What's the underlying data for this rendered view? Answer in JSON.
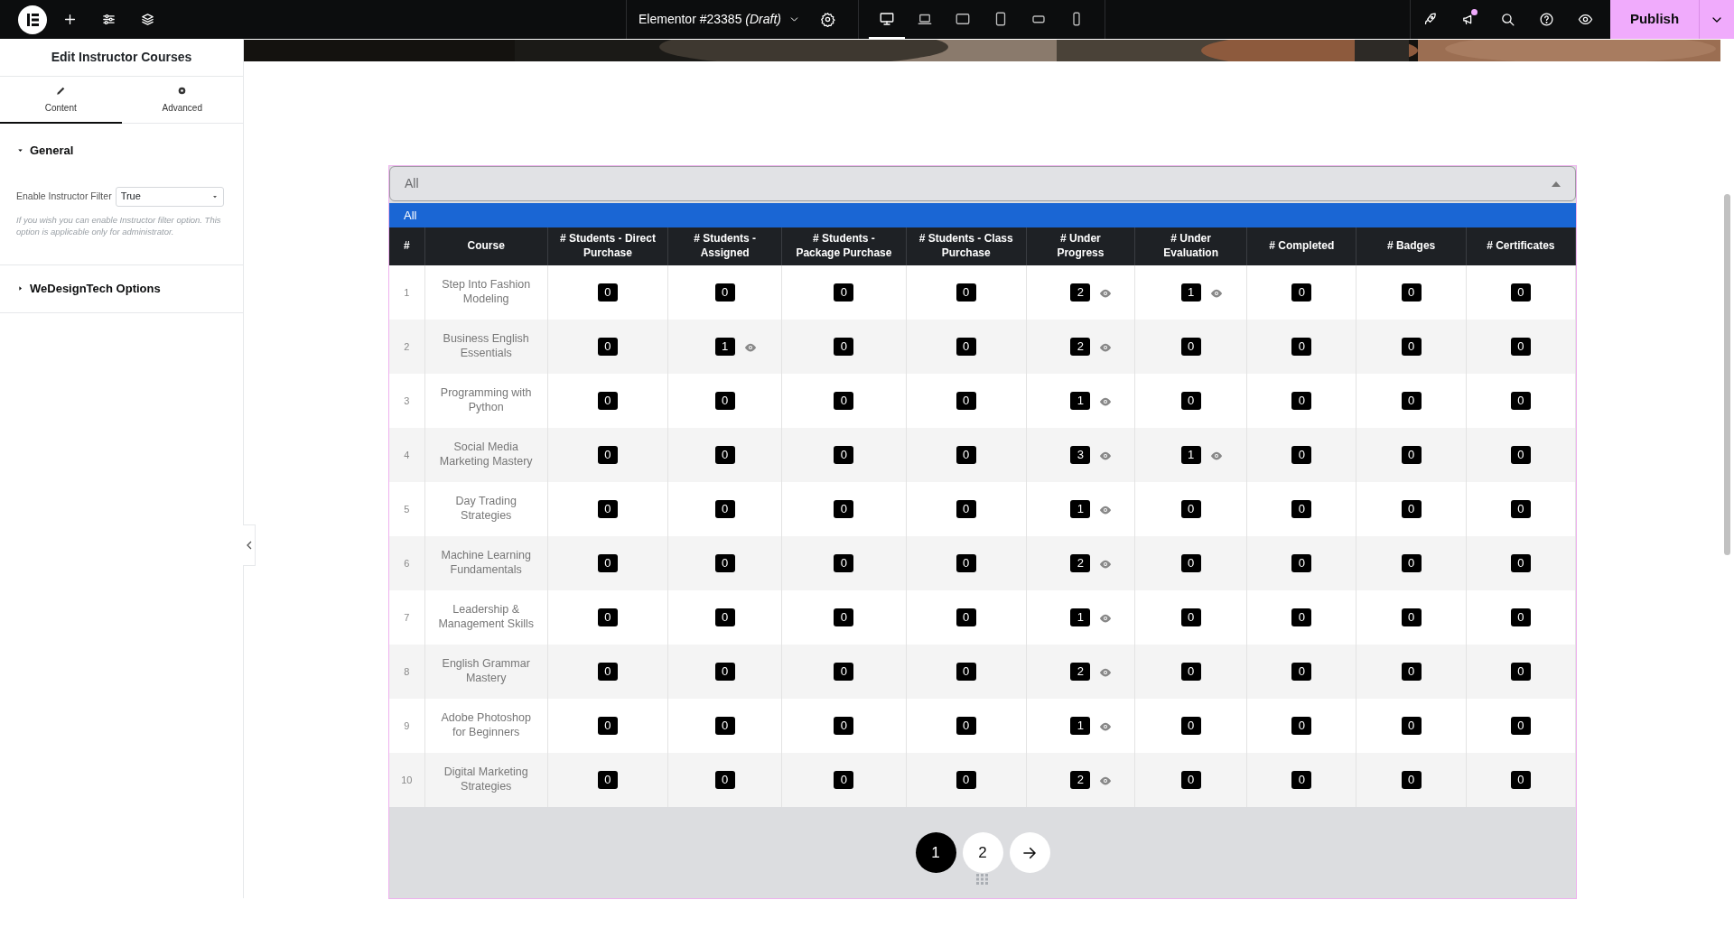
{
  "topbar": {
    "document_title": "Elementor #23385 *(Draft)*",
    "devices": [
      {
        "kind": "desktop",
        "selected": true
      },
      {
        "kind": "laptop",
        "selected": false
      },
      {
        "kind": "tablet-landscape",
        "selected": false
      },
      {
        "kind": "tablet",
        "selected": false
      },
      {
        "kind": "mobile-landscape",
        "selected": false
      },
      {
        "kind": "mobile",
        "selected": false
      }
    ],
    "notification": true,
    "publish_button": "Publish"
  },
  "sidebar": {
    "title": "Edit Instructor Courses",
    "tabs": [
      {
        "label": "Content",
        "kind": "pencil",
        "selected": true
      },
      {
        "label": "Advanced",
        "kind": "gear",
        "selected": false
      }
    ],
    "sections": [
      {
        "title": "General",
        "expanded": true,
        "field_label": "Enable Instructor Filter",
        "field_value": "True",
        "help": "If you wish you can enable Instructor filter option. This option is applicable only for administrator."
      },
      {
        "title": "WeDesignTech Options",
        "expanded": false
      }
    ]
  },
  "widget": {
    "filter_value": "All",
    "open_option": "All",
    "table": {
      "columns": [
        "#",
        "Course",
        "# Students - Direct Purchase",
        "# Students - Assigned",
        "# Students - Package Purchase",
        "# Students - Class Purchase",
        "# Under Progress",
        "# Under Evaluation",
        "# Completed",
        "# Badges",
        "# Certificates"
      ],
      "rows": [
        {
          "cells": [
            {
              "text": "1"
            },
            {
              "text": "Step Into Fashion Modeling"
            },
            {
              "text": "0",
              "viewable": false
            },
            {
              "text": "0",
              "viewable": false
            },
            {
              "text": "0",
              "viewable": false
            },
            {
              "text": "0",
              "viewable": false
            },
            {
              "text": "2",
              "viewable": true
            },
            {
              "text": "1",
              "viewable": true
            },
            {
              "text": "0",
              "viewable": false
            },
            {
              "text": "0",
              "viewable": false
            },
            {
              "text": "0",
              "viewable": false
            }
          ]
        },
        {
          "cells": [
            {
              "text": "2"
            },
            {
              "text": "Business English Essentials"
            },
            {
              "text": "0",
              "viewable": false
            },
            {
              "text": "1",
              "viewable": true
            },
            {
              "text": "0",
              "viewable": false
            },
            {
              "text": "0",
              "viewable": false
            },
            {
              "text": "2",
              "viewable": true
            },
            {
              "text": "0",
              "viewable": false
            },
            {
              "text": "0",
              "viewable": false
            },
            {
              "text": "0",
              "viewable": false
            },
            {
              "text": "0",
              "viewable": false
            }
          ]
        },
        {
          "cells": [
            {
              "text": "3"
            },
            {
              "text": "Programming with Python"
            },
            {
              "text": "0",
              "viewable": false
            },
            {
              "text": "0",
              "viewable": false
            },
            {
              "text": "0",
              "viewable": false
            },
            {
              "text": "0",
              "viewable": false
            },
            {
              "text": "1",
              "viewable": true
            },
            {
              "text": "0",
              "viewable": false
            },
            {
              "text": "0",
              "viewable": false
            },
            {
              "text": "0",
              "viewable": false
            },
            {
              "text": "0",
              "viewable": false
            }
          ]
        },
        {
          "cells": [
            {
              "text": "4"
            },
            {
              "text": "Social Media Marketing Mastery"
            },
            {
              "text": "0",
              "viewable": false
            },
            {
              "text": "0",
              "viewable": false
            },
            {
              "text": "0",
              "viewable": false
            },
            {
              "text": "0",
              "viewable": false
            },
            {
              "text": "3",
              "viewable": true
            },
            {
              "text": "1",
              "viewable": true
            },
            {
              "text": "0",
              "viewable": false
            },
            {
              "text": "0",
              "viewable": false
            },
            {
              "text": "0",
              "viewable": false
            }
          ]
        },
        {
          "cells": [
            {
              "text": "5"
            },
            {
              "text": "Day Trading Strategies"
            },
            {
              "text": "0",
              "viewable": false
            },
            {
              "text": "0",
              "viewable": false
            },
            {
              "text": "0",
              "viewable": false
            },
            {
              "text": "0",
              "viewable": false
            },
            {
              "text": "1",
              "viewable": true
            },
            {
              "text": "0",
              "viewable": false
            },
            {
              "text": "0",
              "viewable": false
            },
            {
              "text": "0",
              "viewable": false
            },
            {
              "text": "0",
              "viewable": false
            }
          ]
        },
        {
          "cells": [
            {
              "text": "6"
            },
            {
              "text": "Machine Learning Fundamentals"
            },
            {
              "text": "0",
              "viewable": false
            },
            {
              "text": "0",
              "viewable": false
            },
            {
              "text": "0",
              "viewable": false
            },
            {
              "text": "0",
              "viewable": false
            },
            {
              "text": "2",
              "viewable": true
            },
            {
              "text": "0",
              "viewable": false
            },
            {
              "text": "0",
              "viewable": false
            },
            {
              "text": "0",
              "viewable": false
            },
            {
              "text": "0",
              "viewable": false
            }
          ]
        },
        {
          "cells": [
            {
              "text": "7"
            },
            {
              "text": "Leadership & Management Skills"
            },
            {
              "text": "0",
              "viewable": false
            },
            {
              "text": "0",
              "viewable": false
            },
            {
              "text": "0",
              "viewable": false
            },
            {
              "text": "0",
              "viewable": false
            },
            {
              "text": "1",
              "viewable": true
            },
            {
              "text": "0",
              "viewable": false
            },
            {
              "text": "0",
              "viewable": false
            },
            {
              "text": "0",
              "viewable": false
            },
            {
              "text": "0",
              "viewable": false
            }
          ]
        },
        {
          "cells": [
            {
              "text": "8"
            },
            {
              "text": "English Grammar Mastery"
            },
            {
              "text": "0",
              "viewable": false
            },
            {
              "text": "0",
              "viewable": false
            },
            {
              "text": "0",
              "viewable": false
            },
            {
              "text": "0",
              "viewable": false
            },
            {
              "text": "2",
              "viewable": true
            },
            {
              "text": "0",
              "viewable": false
            },
            {
              "text": "0",
              "viewable": false
            },
            {
              "text": "0",
              "viewable": false
            },
            {
              "text": "0",
              "viewable": false
            }
          ]
        },
        {
          "cells": [
            {
              "text": "9"
            },
            {
              "text": "Adobe Photoshop for Beginners"
            },
            {
              "text": "0",
              "viewable": false
            },
            {
              "text": "0",
              "viewable": false
            },
            {
              "text": "0",
              "viewable": false
            },
            {
              "text": "0",
              "viewable": false
            },
            {
              "text": "1",
              "viewable": true
            },
            {
              "text": "0",
              "viewable": false
            },
            {
              "text": "0",
              "viewable": false
            },
            {
              "text": "0",
              "viewable": false
            },
            {
              "text": "0",
              "viewable": false
            }
          ]
        },
        {
          "cells": [
            {
              "text": "10"
            },
            {
              "text": "Digital Marketing Strategies"
            },
            {
              "text": "0",
              "viewable": false
            },
            {
              "text": "0",
              "viewable": false
            },
            {
              "text": "0",
              "viewable": false
            },
            {
              "text": "0",
              "viewable": false
            },
            {
              "text": "2",
              "viewable": true
            },
            {
              "text": "0",
              "viewable": false
            },
            {
              "text": "0",
              "viewable": false
            },
            {
              "text": "0",
              "viewable": false
            },
            {
              "text": "0",
              "viewable": false
            }
          ]
        }
      ]
    },
    "pages": [
      {
        "label": "1",
        "selected": true
      },
      {
        "label": "2",
        "selected": false
      }
    ]
  }
}
